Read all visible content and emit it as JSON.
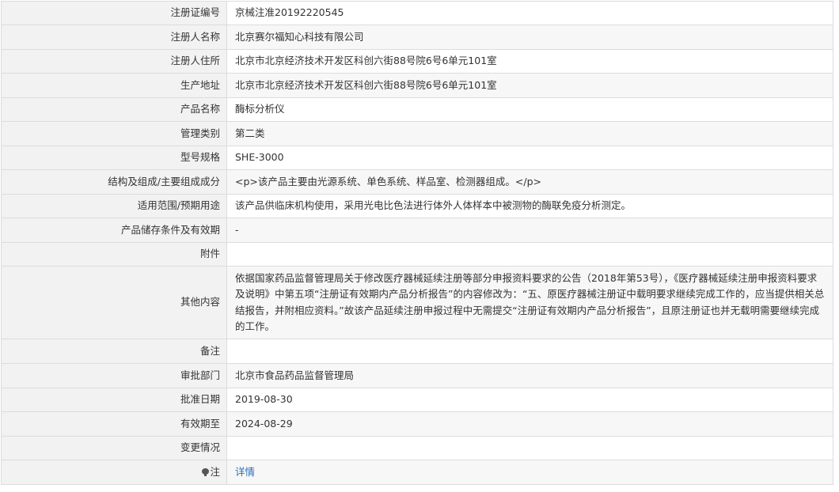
{
  "rows": [
    {
      "label": "注册证编号",
      "value": "京械注准20192220545"
    },
    {
      "label": "注册人名称",
      "value": "北京赛尔福知心科技有限公司"
    },
    {
      "label": "注册人住所",
      "value": "北京市北京经济技术开发区科创六街88号院6号6单元101室"
    },
    {
      "label": "生产地址",
      "value": "北京市北京经济技术开发区科创六街88号院6号6单元101室"
    },
    {
      "label": "产品名称",
      "value": "酶标分析仪"
    },
    {
      "label": "管理类别",
      "value": "第二类"
    },
    {
      "label": "型号规格",
      "value": "SHE-3000"
    },
    {
      "label": "结构及组成/主要组成成分",
      "value": "<p>该产品主要由光源系统、单色系统、样品室、检测器组成。</p>"
    },
    {
      "label": "适用范围/预期用途",
      "value": "该产品供临床机构使用，采用光电比色法进行体外人体样本中被测物的酶联免疫分析测定。"
    },
    {
      "label": "产品储存条件及有效期",
      "value": "-"
    },
    {
      "label": "附件",
      "value": ""
    },
    {
      "label": "其他内容",
      "value": "依据国家药品监督管理局关于修改医疗器械延续注册等部分申报资料要求的公告（2018年第53号），《医疗器械延续注册申报资料要求及说明》中第五项“注册证有效期内产品分析报告”的内容修改为：“五、原医疗器械注册证中载明要求继续完成工作的，应当提供相关总结报告，并附相应资料。”故该产品延续注册申报过程中无需提交“注册证有效期内产品分析报告”，且原注册证也并无载明需要继续完成的工作。"
    },
    {
      "label": "备注",
      "value": ""
    },
    {
      "label": "审批部门",
      "value": "北京市食品药品监督管理局"
    },
    {
      "label": "批准日期",
      "value": "2019-08-30"
    },
    {
      "label": "有效期至",
      "value": "2024-08-29"
    },
    {
      "label": "变更情况",
      "value": ""
    }
  ],
  "note_row": {
    "label": "注",
    "link_text": "详情",
    "icon": "lightbulb-icon"
  },
  "colors": {
    "label_bg": "#f2f2f2",
    "alt_row_bg": "#f7f7f7",
    "border": "#dcdcdc",
    "link": "#2a6ebb"
  }
}
